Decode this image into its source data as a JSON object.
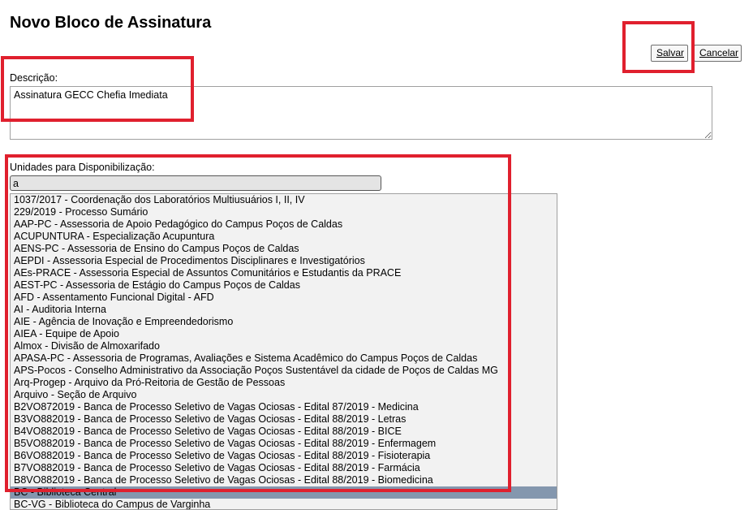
{
  "page": {
    "title": "Novo Bloco de Assinatura"
  },
  "toolbar": {
    "save_label": "Salvar",
    "cancel_label": "Cancelar"
  },
  "form": {
    "description_label": "Descrição:",
    "description_value": "Assinatura GECC Chefia Imediata",
    "units_label": "Unidades para Disponibilização:",
    "filter_value": "a",
    "options": [
      "1037/2017 - Coordenação dos Laboratórios Multiusuários I, II, IV",
      "229/2019 - Processo Sumário",
      "AAP-PC - Assessoria de Apoio Pedagógico do Campus Poços de Caldas",
      "ACUPUNTURA - Especialização Acupuntura",
      "AENS-PC - Assessoria de Ensino do Campus Poços de Caldas",
      "AEPDI - Assessoria Especial de Procedimentos Disciplinares e Investigatórios",
      "AEs-PRACE - Assessoria Especial de Assuntos Comunitários e Estudantis da PRACE",
      "AEST-PC - Assessoria de Estágio do Campus Poços de Caldas",
      "AFD - Assentamento Funcional Digital - AFD",
      "AI - Auditoria Interna",
      "AIE - Agência de Inovação e Empreendedorismo",
      "AIEA - Equipe de Apoio",
      "Almox - Divisão de Almoxarifado",
      "APASA-PC - Assessoria de Programas, Avaliações e Sistema Acadêmico do Campus Poços de Caldas",
      "APS-Pocos - Conselho Administrativo da Associação Poços Sustentável da cidade de Poços de Caldas MG",
      "Arq-Progep - Arquivo da Pró-Reitoria de Gestão de Pessoas",
      "Arquivo - Seção de Arquivo",
      "B2VO872019 - Banca de Processo Seletivo de Vagas Ociosas - Edital 87/2019 - Medicina",
      "B3VO882019 - Banca de Processo Seletivo de Vagas Ociosas - Edital 88/2019 - Letras",
      "B4VO882019 - Banca de Processo Seletivo de Vagas Ociosas - Edital 88/2019 - BICE",
      "B5VO882019 - Banca de Processo Seletivo de Vagas Ociosas - Edital 88/2019 - Enfermagem",
      "B6VO882019 - Banca de Processo Seletivo de Vagas Ociosas - Edital 88/2019 - Fisioterapia",
      "B7VO882019 - Banca de Processo Seletivo de Vagas Ociosas - Edital 88/2019 - Farmácia",
      "B8VO882019 - Banca de Processo Seletivo de Vagas Ociosas - Edital 88/2019 - Biomedicina",
      "BC - Biblioteca Central",
      "BC-VG - Biblioteca do Campus de Varginha"
    ],
    "selected_option": "BC - Biblioteca Central"
  },
  "colors": {
    "highlight_border": "#e0202e",
    "selected_row": "#8497ae",
    "listbox_bg": "#f2f2f2"
  }
}
